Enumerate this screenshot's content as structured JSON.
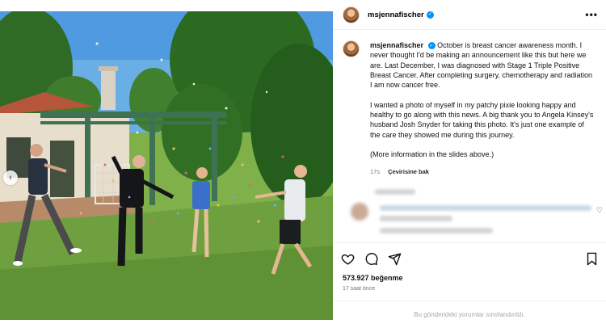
{
  "post": {
    "username": "msjennafischer",
    "verified": true,
    "caption_paragraphs": [
      "October is breast cancer awareness month. I never thought I'd be making an announcement like this but here we are. Last December, I was diagnosed with Stage 1 Triple Positive Breast Cancer. After completing surgery, chemotherapy and radiation I am now cancer free.",
      "I wanted a photo of myself in my patchy pixie looking happy and healthy to go along with this news. A big thank you to Angela Kinsey's husband Josh Snyder for taking this photo. It's just one example of the care they showed me during this journey.",
      "(More information in the slides above.)"
    ],
    "age": "17s",
    "translate_label": "Çevirisine bak",
    "likes": "573.927 beğenme",
    "posted": "17 saat önce",
    "comments_limited": "Bu gönderideki yorumlar sınırlandırıldı."
  },
  "icons": {
    "more": "more-options-icon",
    "like": "heart-icon",
    "comment": "comment-icon",
    "share": "share-icon",
    "save": "bookmark-icon",
    "prev": "chevron-left-icon"
  },
  "colors": {
    "verified": "#0095f6",
    "muted": "#737373",
    "lawn": "#6fa03f"
  }
}
